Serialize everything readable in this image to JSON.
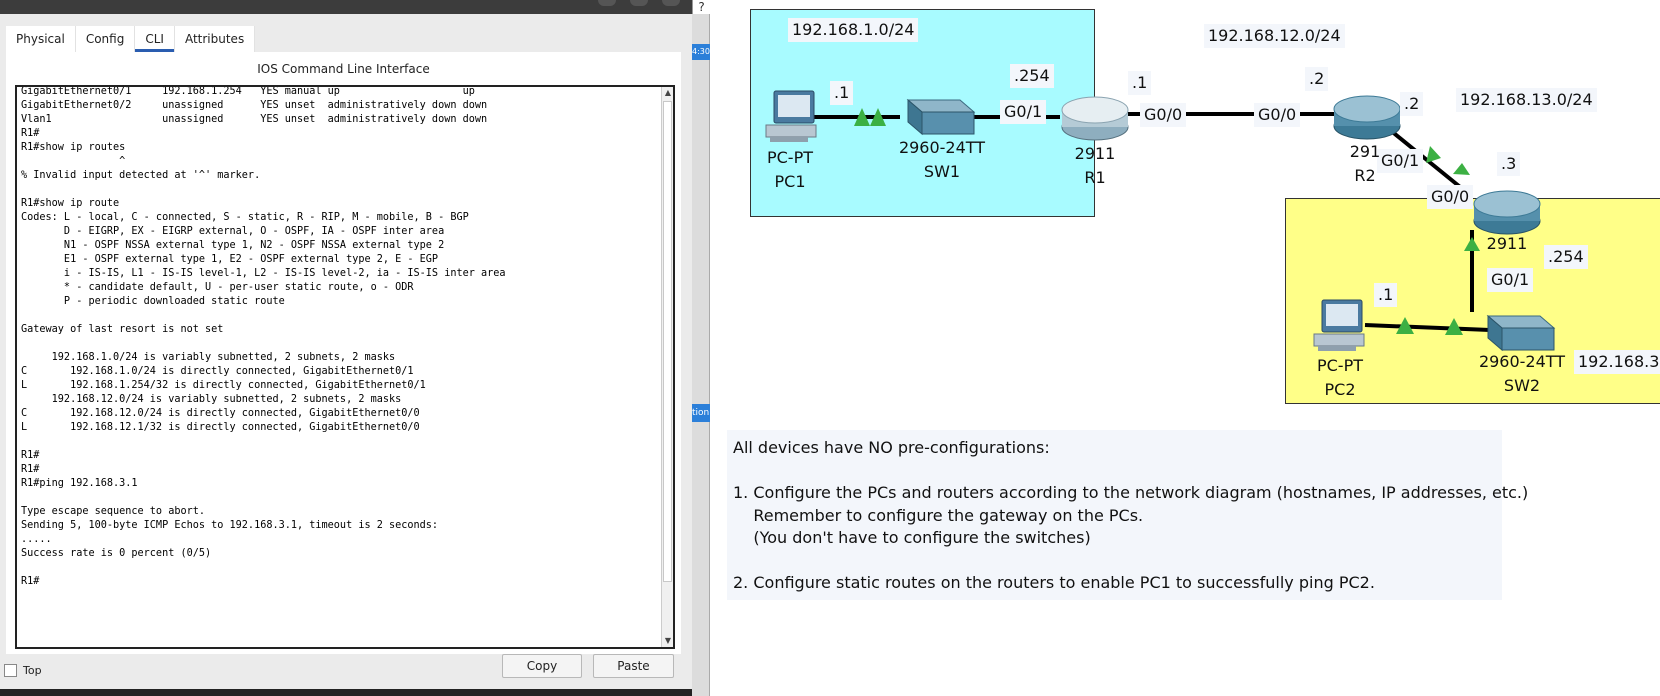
{
  "dialog": {
    "help_button": "?",
    "tabs": [
      {
        "label": "Physical",
        "active": false
      },
      {
        "label": "Config",
        "active": false
      },
      {
        "label": "CLI",
        "active": true
      },
      {
        "label": "Attributes",
        "active": false
      }
    ],
    "cli_title": "IOS Command Line Interface",
    "terminal_lines": [
      "GigabitEthernet0/1     192.168.1.254   YES manual up                    up",
      "GigabitEthernet0/2     unassigned      YES unset  administratively down down",
      "Vlan1                  unassigned      YES unset  administratively down down",
      "R1#",
      "R1#show ip routes",
      "                ^",
      "% Invalid input detected at '^' marker.",
      "",
      "R1#show ip route",
      "Codes: L - local, C - connected, S - static, R - RIP, M - mobile, B - BGP",
      "       D - EIGRP, EX - EIGRP external, O - OSPF, IA - OSPF inter area",
      "       N1 - OSPF NSSA external type 1, N2 - OSPF NSSA external type 2",
      "       E1 - OSPF external type 1, E2 - OSPF external type 2, E - EGP",
      "       i - IS-IS, L1 - IS-IS level-1, L2 - IS-IS level-2, ia - IS-IS inter area",
      "       * - candidate default, U - per-user static route, o - ODR",
      "       P - periodic downloaded static route",
      "",
      "Gateway of last resort is not set",
      "",
      "     192.168.1.0/24 is variably subnetted, 2 subnets, 2 masks",
      "C       192.168.1.0/24 is directly connected, GigabitEthernet0/1",
      "L       192.168.1.254/32 is directly connected, GigabitEthernet0/1",
      "     192.168.12.0/24 is variably subnetted, 2 subnets, 2 masks",
      "C       192.168.12.0/24 is directly connected, GigabitEthernet0/0",
      "L       192.168.12.1/32 is directly connected, GigabitEthernet0/0",
      "",
      "R1#",
      "R1#",
      "R1#ping 192.168.3.1",
      "",
      "Type escape sequence to abort.",
      "Sending 5, 100-byte ICMP Echos to 192.168.3.1, timeout is 2 seconds:",
      ".....",
      "Success rate is 0 percent (0/5)",
      "",
      "R1#"
    ],
    "copy_label": "Copy",
    "paste_label": "Paste",
    "top_label": "Top",
    "top_checked": false
  },
  "side_strip": {
    "tag_top": "4:30",
    "tag_mid": "tion"
  },
  "diagram": {
    "subnet_labels": {
      "net1": "192.168.1.0/24",
      "net12": "192.168.12.0/24",
      "net13": "192.168.13.0/24",
      "net3": "192.168.3"
    },
    "address_labels": {
      "pc1_ip": ".1",
      "r1_g01_ip": ".254",
      "r1_g00_ip": ".1",
      "r2_g00_ip": ".2",
      "r2_g01_ip": ".2",
      "r3_g00_ip": ".3",
      "r3_g01_ip": ".254",
      "pc2_ip": ".1"
    },
    "interface_labels": {
      "r1_g01": "G0/1",
      "r1_g00": "G0/0",
      "r2_g00": "G0/0",
      "r2_g01": "G0/1",
      "r3_g00": "G0/0",
      "r3_g01": "G0/1"
    },
    "devices": {
      "pc1": {
        "model": "PC-PT",
        "name": "PC1"
      },
      "sw1": {
        "model": "2960-24TT",
        "name": "SW1"
      },
      "r1": {
        "model": "2911",
        "name": "R1"
      },
      "r2": {
        "model": "291",
        "name": "R2"
      },
      "r3": {
        "model": "2911",
        "name": ""
      },
      "pc2": {
        "model": "PC-PT",
        "name": "PC2"
      },
      "sw2": {
        "model": "2960-24TT",
        "name": "SW2"
      }
    },
    "colors": {
      "zone1": "#a8fbff",
      "zone2": "#ffff88",
      "link": "#000000",
      "link_up": "#3cb043"
    },
    "task": {
      "text": "All devices have NO pre-configurations:\n\n1. Configure the PCs and routers according to the network diagram (hostnames, IP addresses, etc.)\n    Remember to configure the gateway on the PCs.\n    (You don't have to configure the switches)\n\n2. Configure static routes on the routers to enable PC1 to successfully ping PC2."
    }
  }
}
